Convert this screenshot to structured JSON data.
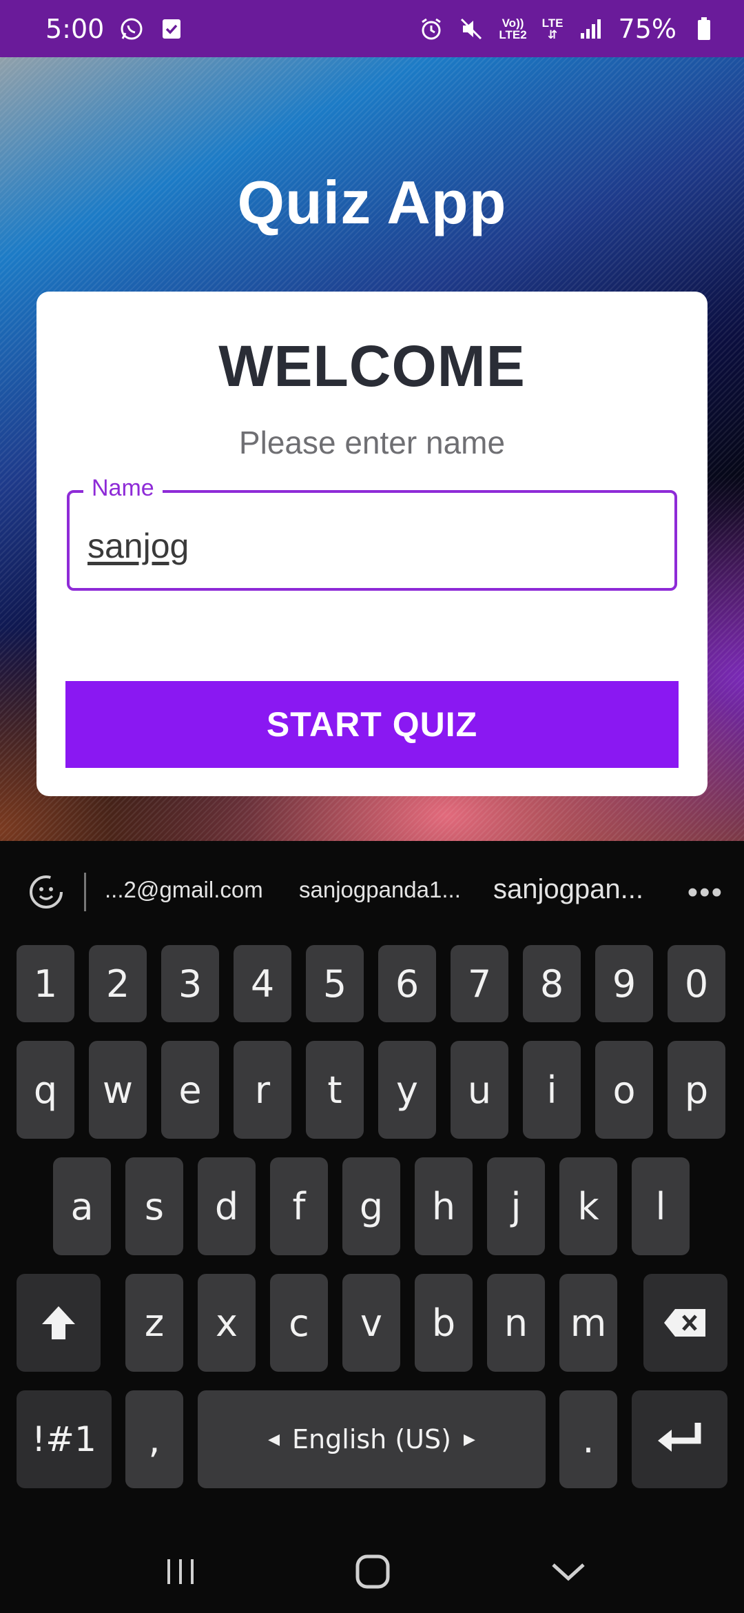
{
  "status_bar": {
    "time": "5:00",
    "battery": "75%",
    "network_top": "Vo))",
    "network_bottom": "LTE2",
    "lte": "LTE"
  },
  "app": {
    "title": "Quiz App",
    "card": {
      "heading": "WELCOME",
      "subtitle": "Please enter name",
      "name_field": {
        "label": "Name",
        "value": "sanjog"
      },
      "start_button": "START QUIZ"
    }
  },
  "keyboard": {
    "suggestions": [
      "...2@gmail.com",
      "sanjogpanda1...",
      "sanjogpan..."
    ],
    "more": "•••",
    "row_numbers": [
      "1",
      "2",
      "3",
      "4",
      "5",
      "6",
      "7",
      "8",
      "9",
      "0"
    ],
    "row1": [
      "q",
      "w",
      "e",
      "r",
      "t",
      "y",
      "u",
      "i",
      "o",
      "p"
    ],
    "row2": [
      "a",
      "s",
      "d",
      "f",
      "g",
      "h",
      "j",
      "k",
      "l"
    ],
    "row3": [
      "z",
      "x",
      "c",
      "v",
      "b",
      "n",
      "m"
    ],
    "symbols": "!#1",
    "comma": ",",
    "space": "English (US)",
    "period": "."
  },
  "colors": {
    "status_bar": "#6a1b9a",
    "accent": "#8a18f2",
    "field_border": "#8e2bd7"
  }
}
